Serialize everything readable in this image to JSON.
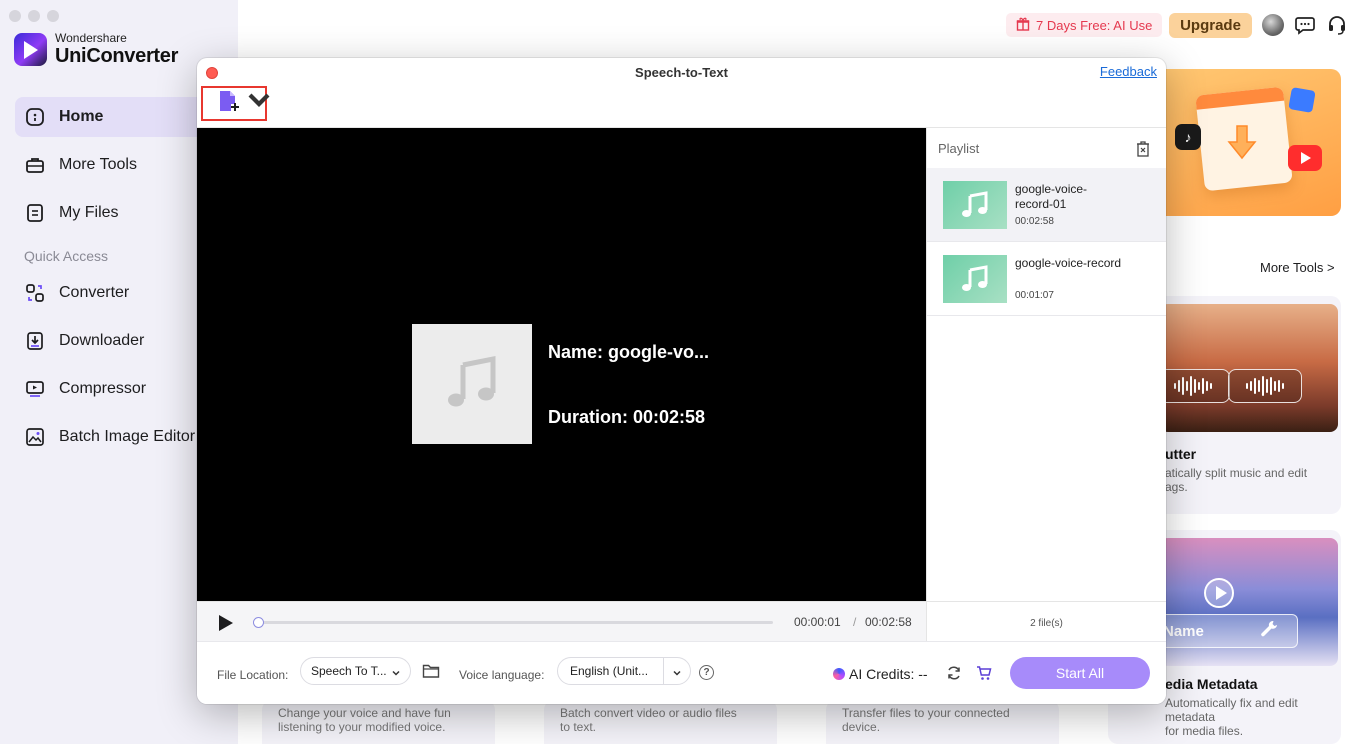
{
  "app": {
    "brand_small": "Wondershare",
    "brand_name": "UniConverter"
  },
  "sidebar": {
    "items": [
      {
        "label": "Home",
        "icon": "home-icon",
        "active": true
      },
      {
        "label": "More Tools",
        "icon": "toolbox-icon"
      },
      {
        "label": "My Files",
        "icon": "file-icon"
      }
    ],
    "quick_access_label": "Quick Access",
    "quick_items": [
      {
        "label": "Converter",
        "icon": "converter-icon"
      },
      {
        "label": "Downloader",
        "icon": "downloader-icon"
      },
      {
        "label": "Compressor",
        "icon": "compressor-icon"
      },
      {
        "label": "Batch Image Editor",
        "icon": "image-editor-icon"
      }
    ]
  },
  "topbar": {
    "promo_text": "7 Days Free: AI Use",
    "upgrade_label": "Upgrade"
  },
  "background": {
    "more_tools_link": "More Tools >",
    "card1": {
      "title": "utter",
      "desc": "atically split music and edit\nags."
    },
    "card2": {
      "title": "edia Metadata",
      "desc": "Automatically fix and edit metadata\nfor media files.",
      "overlay": "Name"
    },
    "bottom_cards": [
      "Change your voice and have fun\nlistening to your modified voice.",
      "Batch convert video or audio files\nto text.",
      "Transfer files to your connected\ndevice."
    ]
  },
  "modal": {
    "title": "Speech-to-Text",
    "feedback_label": "Feedback",
    "player": {
      "name_text": "Name: google-vo...",
      "duration_text": "Duration: 00:02:58",
      "current_time": "00:00:01",
      "separator": "/",
      "total_time": "00:02:58",
      "progress": 0.0
    },
    "playlist": {
      "header": "Playlist",
      "items": [
        {
          "name": "google-voice-record-01",
          "duration": "00:02:58",
          "selected": true
        },
        {
          "name": "google-voice-record",
          "duration": "00:01:07",
          "selected": false
        }
      ],
      "file_count": "2 file(s)"
    },
    "footer": {
      "file_location_label": "File Location:",
      "file_location_value": "Speech To T...",
      "voice_language_label": "Voice language:",
      "voice_language_value": "English (Unit...",
      "ai_credits_label": "AI Credits:  --",
      "start_all_label": "Start All"
    }
  },
  "colors": {
    "accent": "#a78bfa",
    "highlight_box": "#e8372f",
    "promo_text": "#e5394f",
    "upgrade_bg": "#fbd29b",
    "link": "#1a6bd8"
  }
}
